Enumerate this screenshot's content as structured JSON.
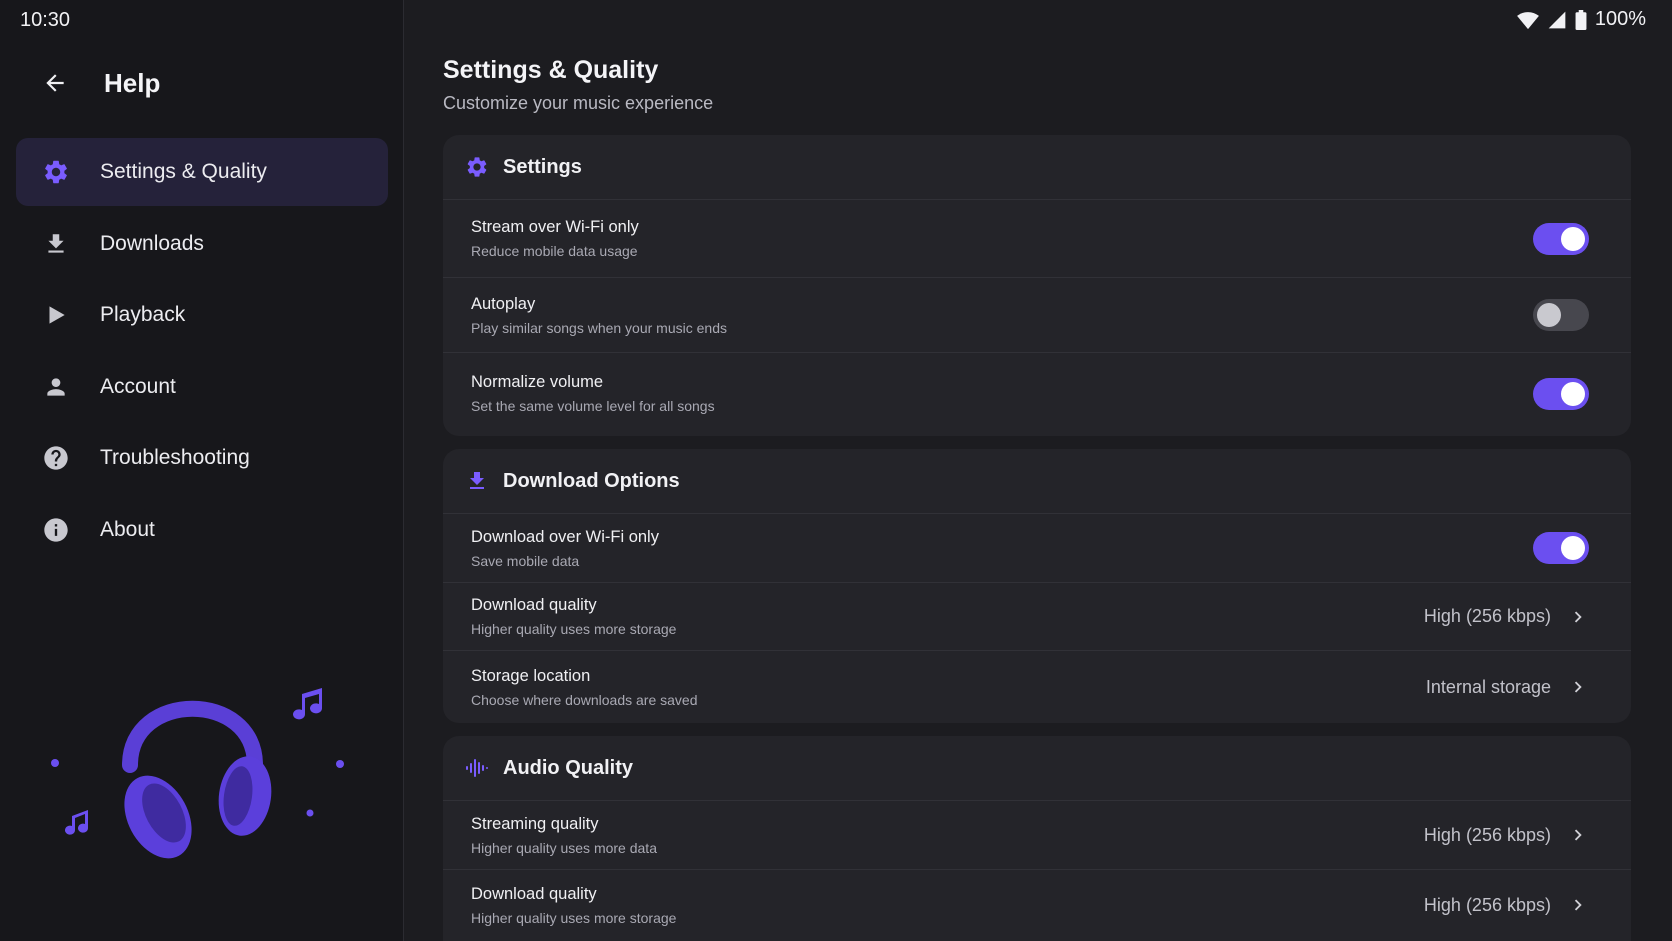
{
  "status": {
    "time": "10:30",
    "battery": "100%"
  },
  "sidebar": {
    "title": "Help",
    "items": [
      {
        "label": "Settings & Quality",
        "icon": "gear-icon",
        "active": true
      },
      {
        "label": "Downloads",
        "icon": "download-icon"
      },
      {
        "label": "Playback",
        "icon": "play-icon"
      },
      {
        "label": "Account",
        "icon": "person-icon"
      },
      {
        "label": "Troubleshooting",
        "icon": "help-circle-icon"
      },
      {
        "label": "About",
        "icon": "info-icon"
      }
    ]
  },
  "main": {
    "title": "Settings & Quality",
    "subtitle": "Customize your music experience",
    "cards": [
      {
        "title": "Settings",
        "icon": "gear-icon",
        "rows": [
          {
            "title": "Stream over Wi-Fi only",
            "subtitle": "Reduce mobile data usage",
            "toggle": true
          },
          {
            "title": "Autoplay",
            "subtitle": "Play similar songs when your music ends",
            "toggle": false
          },
          {
            "title": "Normalize volume",
            "subtitle": "Set the same volume level for all songs",
            "toggle": true
          }
        ]
      },
      {
        "title": "Download Options",
        "icon": "download-icon",
        "rows": [
          {
            "title": "Download over Wi-Fi only",
            "subtitle": "Save mobile data",
            "toggle": true
          },
          {
            "title": "Download quality",
            "subtitle": "Higher quality uses more storage",
            "value": "High (256 kbps)"
          },
          {
            "title": "Storage location",
            "subtitle": "Choose where downloads are saved",
            "value": "Internal storage"
          }
        ]
      },
      {
        "title": "Audio Quality",
        "icon": "waveform-icon",
        "rows": [
          {
            "title": "Streaming quality",
            "subtitle": "Higher quality uses more data",
            "value": "High (256 kbps)"
          },
          {
            "title": "Download quality",
            "subtitle": "Higher quality uses more storage",
            "value": "High (256 kbps)"
          }
        ]
      }
    ]
  },
  "colors": {
    "accent": "#6b4ff0",
    "accent_icon": "#7a5cff",
    "background": "#1c1c20",
    "card": "#242429",
    "active_nav": "#25223a"
  }
}
